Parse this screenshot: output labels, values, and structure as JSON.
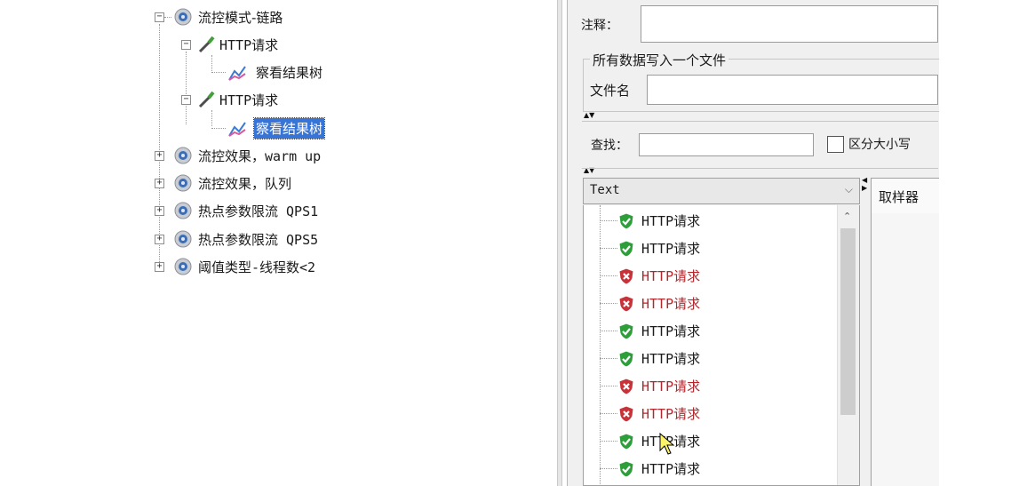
{
  "tree": {
    "items": [
      {
        "label": "流控模式-链路",
        "type": "thread-group",
        "expanded": true
      },
      {
        "label": "HTTP请求",
        "type": "sampler",
        "expanded": true
      },
      {
        "label": "察看结果树",
        "type": "listener"
      },
      {
        "label": "HTTP请求",
        "type": "sampler",
        "expanded": true
      },
      {
        "label": "察看结果树",
        "type": "listener",
        "selected": true
      },
      {
        "label": "流控效果，warm up",
        "type": "thread-group",
        "expanded": false
      },
      {
        "label": "流控效果，队列",
        "type": "thread-group",
        "expanded": false
      },
      {
        "label": "热点参数限流 QPS1",
        "type": "thread-group",
        "expanded": false
      },
      {
        "label": "热点参数限流 QPS5",
        "type": "thread-group",
        "expanded": false
      },
      {
        "label": "阈值类型-线程数<2",
        "type": "thread-group",
        "expanded": false
      }
    ]
  },
  "form": {
    "comment_label": "注释：",
    "comment_value": "",
    "file_group_title": "所有数据写入一个文件",
    "filename_label": "文件名",
    "filename_value": ""
  },
  "search": {
    "label": "查找：",
    "value": "",
    "case_label": "区分大小写",
    "case_checked": false
  },
  "results": {
    "renderer": "Text",
    "right_tab": "取样器",
    "items": [
      {
        "label": "HTTP请求",
        "status": "success"
      },
      {
        "label": "HTTP请求",
        "status": "success"
      },
      {
        "label": "HTTP请求",
        "status": "error"
      },
      {
        "label": "HTTP请求",
        "status": "error"
      },
      {
        "label": "HTTP请求",
        "status": "success"
      },
      {
        "label": "HTTP请求",
        "status": "success"
      },
      {
        "label": "HTTP请求",
        "status": "error"
      },
      {
        "label": "HTTP请求",
        "status": "error"
      },
      {
        "label": "HTTP请求",
        "status": "success"
      },
      {
        "label": "HTTP请求",
        "status": "success"
      }
    ]
  },
  "colors": {
    "success": "#2e9e3a",
    "error": "#c8333a",
    "selection": "#3874d6",
    "panel_bg": "#f0f0f0"
  }
}
